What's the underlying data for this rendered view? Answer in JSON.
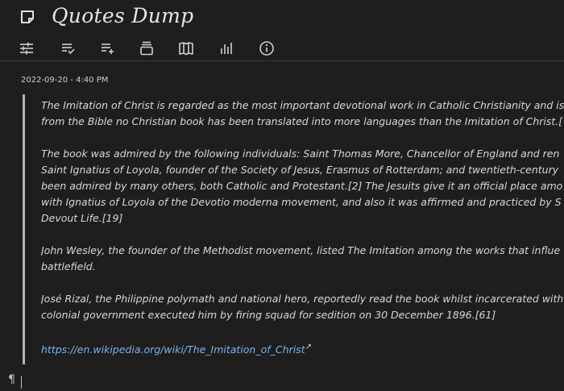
{
  "app": {
    "title": "Quotes Dump"
  },
  "toolbar": {
    "buttons": [
      {
        "name": "settings",
        "icon": "sliders-icon"
      },
      {
        "name": "checklist",
        "icon": "list-check-icon"
      },
      {
        "name": "add-item",
        "icon": "playlist-add-icon"
      },
      {
        "name": "archive",
        "icon": "archive-icon"
      },
      {
        "name": "book",
        "icon": "book-open-icon"
      },
      {
        "name": "stats",
        "icon": "bar-chart-icon"
      },
      {
        "name": "info",
        "icon": "info-icon"
      }
    ]
  },
  "note": {
    "timestamp": "2022-09-20 - 4:40 PM",
    "paragraphs": [
      {
        "line1": "The Imitation of Christ is regarded as the most important devotional work in Catholic Christianity and is",
        "line2": "from the Bible no Christian book has been translated into more languages than the Imitation of Christ.["
      },
      {
        "line1": "The book was admired by the following individuals: Saint Thomas More, Chancellor of England and ren",
        "line2": "Saint Ignatius of Loyola, founder of the Society of Jesus, Erasmus of Rotterdam; and twentieth-century",
        "line3": "been admired by many others, both Catholic and Protestant.[2] The Jesuits give it an official place amo",
        "line4": "with Ignatius of Loyola of the Devotio moderna movement, and also it was affirmed and practiced by S",
        "line5": "Devout Life.[19]"
      },
      {
        "line1": "John Wesley, the founder of the Methodist movement, listed The Imitation among the works that influe",
        "line2": "battlefield."
      },
      {
        "line1": "José Rizal, the Philippine polymath and national hero, reportedly read the book whilst incarcerated with",
        "line2": "colonial government executed him by firing squad for sedition on 30 December 1896.[61]"
      }
    ],
    "link": "https://en.wikipedia.org/wiki/The_Imitation_of_Christ",
    "link_mark": "↗",
    "pilcrow": "¶"
  },
  "colors": {
    "background": "#1e1e1e",
    "text": "#d8d8d8",
    "link": "#7ab4e8",
    "quote_bar": "#b4b4b4"
  }
}
